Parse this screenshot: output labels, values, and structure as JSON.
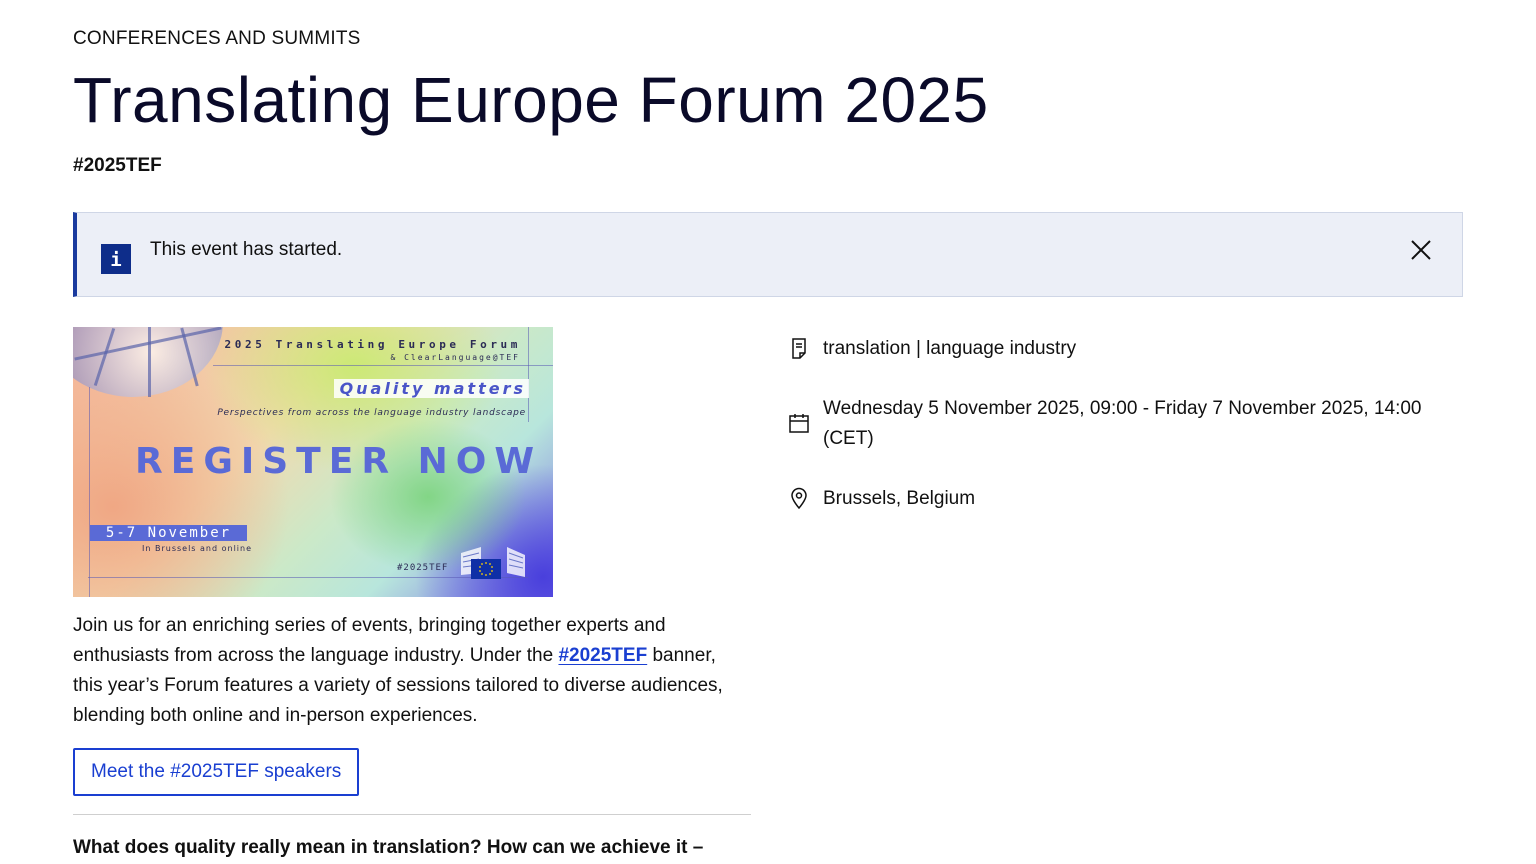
{
  "header": {
    "kicker": "CONFERENCES AND SUMMITS",
    "title": "Translating Europe Forum 2025",
    "hashtag": "#2025TEF"
  },
  "alert": {
    "text": "This event has started.",
    "icon": "info-icon",
    "close_icon": "close-icon"
  },
  "banner": {
    "title": "2025 Translating Europe Forum",
    "subtitle": "& ClearLanguage@TEF",
    "tagline": "Quality matters",
    "perspectives": "Perspectives from across the language industry landscape",
    "cta": "REGISTER NOW",
    "dates": "5-7 November",
    "location": "In Brussels and online",
    "hashtag": "#2025TEF"
  },
  "intro": {
    "text_before": "Join us for an enriching series of events, bringing together experts and enthusiasts from across the language industry. Under the",
    "link": "#2025TEF",
    "text_after": "banner, this year’s Forum features a variety of sessions tailored to diverse audiences, blending both online and in-person experiences."
  },
  "cta_button": {
    "label": "Meet the #2025TEF speakers"
  },
  "question": {
    "text": "What does quality really mean in translation? How can we achieve it –"
  },
  "meta": {
    "topics": "translation | language industry",
    "datetime": "Wednesday 5 November 2025, 09:00 - Friday 7 November 2025, 14:00 (CET)",
    "location": "Brussels, Belgium"
  },
  "colors": {
    "title": "#0a0a29",
    "accent_blue": "#1a3fd1",
    "alert_bg": "#eceff7",
    "alert_border": "#1a3a9e",
    "info_icon_bg": "#0e2d8a"
  }
}
